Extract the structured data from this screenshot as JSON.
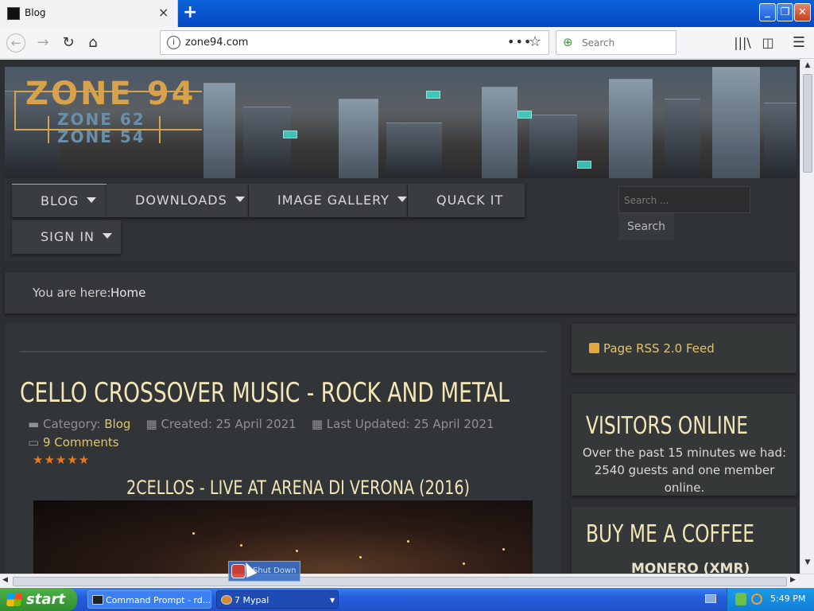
{
  "browser": {
    "tab_title": "Blog",
    "url": "zone94.com",
    "search_placeholder": "Search",
    "new_tab_symbol": "+",
    "close_symbol": "×"
  },
  "site": {
    "logo": "ZONE 94",
    "logo_sub1": "ZONE 62",
    "logo_sub2": "ZONE 54",
    "menu": [
      {
        "label": "BLOG",
        "has_dropdown": true,
        "active": true
      },
      {
        "label": "DOWNLOADS",
        "has_dropdown": true
      },
      {
        "label": "IMAGE GALLERY",
        "has_dropdown": true
      },
      {
        "label": "QUACK IT",
        "has_dropdown": false
      },
      {
        "label": "SIGN IN",
        "has_dropdown": true
      }
    ],
    "search_placeholder": "Search ...",
    "search_button": "Search",
    "breadcrumb_label": "You are here:",
    "breadcrumb_home": "Home"
  },
  "article": {
    "title": "CELLO CROSSOVER MUSIC - ROCK AND METAL",
    "category_label": "Category:",
    "category": "Blog",
    "created": "Created: 25 April 2021",
    "updated": "Last Updated: 25 April 2021",
    "comments": "9 Comments",
    "rating_stars": "★★★★★",
    "rating_value": 5,
    "video_title": "2CELLOS - LIVE AT ARENA DI VERONA (2016)"
  },
  "sidebar": {
    "rss": "Page RSS 2.0 Feed",
    "visitors_title": "VISITORS ONLINE",
    "visitors_text": "Over the past 15 minutes we had: 2540 guests and one member online.",
    "coffee_title": "BUY ME A COFFEE",
    "coffee_sub": "MONERO (XMR)"
  },
  "overlay": {
    "tooltip": "Shut Down"
  },
  "taskbar": {
    "start": "start",
    "tasks": [
      "Command Prompt - rd...",
      "7 Mypal"
    ],
    "clock": "5:49 PM"
  },
  "colors": {
    "accent_gold": "#e2c46d",
    "title_cream": "#f4e6b6",
    "page_bg": "#2c2f31",
    "xp_blue": "#245edb",
    "star_orange": "#e87a1e"
  },
  "icons": [
    "back-icon",
    "forward-icon",
    "reload-icon",
    "home-icon",
    "info-icon",
    "page-actions-icon",
    "bookmark-star-icon",
    "search-icon",
    "library-icon",
    "sidebar-icon",
    "menu-icon",
    "folder-icon",
    "calendar-icon",
    "comment-icon",
    "rss-icon",
    "windows-flag-icon"
  ]
}
